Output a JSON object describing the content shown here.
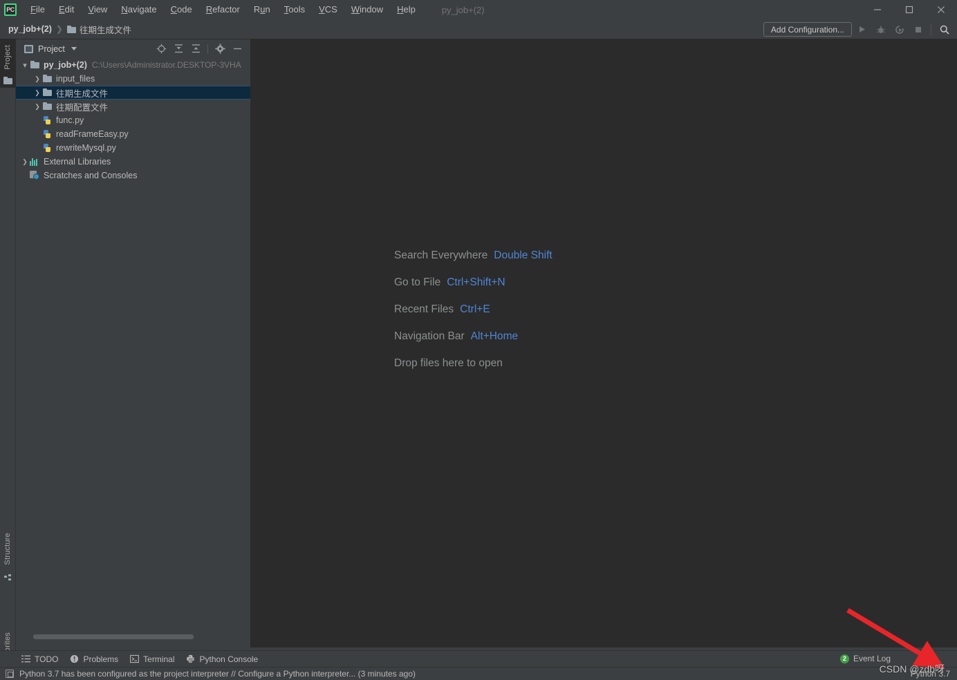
{
  "window": {
    "title": "py_job+(2)",
    "minimize_label": "Minimize",
    "maximize_label": "Maximize",
    "close_label": "Close",
    "logo_text": "PC"
  },
  "menu": {
    "items": [
      {
        "label": "File",
        "mnemonic": "F"
      },
      {
        "label": "Edit",
        "mnemonic": "E"
      },
      {
        "label": "View",
        "mnemonic": "V"
      },
      {
        "label": "Navigate",
        "mnemonic": "N"
      },
      {
        "label": "Code",
        "mnemonic": "C"
      },
      {
        "label": "Refactor",
        "mnemonic": "R"
      },
      {
        "label": "Run",
        "mnemonic": "u"
      },
      {
        "label": "Tools",
        "mnemonic": "T"
      },
      {
        "label": "VCS",
        "mnemonic": "V"
      },
      {
        "label": "Window",
        "mnemonic": "W"
      },
      {
        "label": "Help",
        "mnemonic": "H"
      }
    ]
  },
  "navbar": {
    "project_crumb": "py_job+(2)",
    "separator": "❯",
    "folder_crumb": "往期生成文件",
    "add_configuration": "Add Configuration...",
    "icons": [
      "run-icon",
      "debug-icon",
      "run-coverage-icon",
      "stop-icon",
      "search-icon"
    ]
  },
  "left_rail": {
    "top_label": "Project",
    "structure_label": "Structure",
    "favorites_label": "Favorites"
  },
  "project_panel": {
    "header_label": "Project",
    "toolbar_icons": [
      "select-opened-file-icon",
      "expand-all-icon",
      "collapse-all-icon",
      "settings-gear-icon",
      "hide-icon"
    ],
    "tree": [
      {
        "depth": 0,
        "arrow": "down",
        "icon": "folder-icon",
        "label": "py_job+(2)",
        "bold": true,
        "path": "C:\\Users\\Administrator.DESKTOP-3VHA",
        "selected": false
      },
      {
        "depth": 1,
        "arrow": "right",
        "icon": "folder-icon",
        "label": "input_files",
        "bold": false,
        "path": "",
        "selected": false
      },
      {
        "depth": 1,
        "arrow": "right",
        "icon": "folder-icon",
        "label": "往期生成文件",
        "bold": false,
        "path": "",
        "selected": true
      },
      {
        "depth": 1,
        "arrow": "right",
        "icon": "folder-icon",
        "label": "往期配置文件",
        "bold": false,
        "path": "",
        "selected": false
      },
      {
        "depth": 1,
        "arrow": "none",
        "icon": "python-file-icon",
        "label": "func.py",
        "bold": false,
        "path": "",
        "selected": false
      },
      {
        "depth": 1,
        "arrow": "none",
        "icon": "python-file-icon",
        "label": "readFrameEasy.py",
        "bold": false,
        "path": "",
        "selected": false
      },
      {
        "depth": 1,
        "arrow": "none",
        "icon": "python-file-icon",
        "label": "rewriteMysql.py",
        "bold": false,
        "path": "",
        "selected": false
      },
      {
        "depth": 0,
        "arrow": "right",
        "icon": "external-libraries-icon",
        "label": "External Libraries",
        "bold": false,
        "path": "",
        "selected": false
      },
      {
        "depth": 0,
        "arrow": "none",
        "icon": "scratches-icon",
        "label": "Scratches and Consoles",
        "bold": false,
        "path": "",
        "selected": false
      }
    ]
  },
  "editor": {
    "tips": [
      {
        "label": "Search Everywhere",
        "key": "Double Shift"
      },
      {
        "label": "Go to File",
        "key": "Ctrl+Shift+N"
      },
      {
        "label": "Recent Files",
        "key": "Ctrl+E"
      },
      {
        "label": "Navigation Bar",
        "key": "Alt+Home"
      },
      {
        "label": "Drop files here to open",
        "key": ""
      }
    ]
  },
  "bottom_bar": {
    "items": [
      {
        "label": "TODO",
        "icon": "todo-list-icon"
      },
      {
        "label": "Problems",
        "icon": "problems-icon"
      },
      {
        "label": "Terminal",
        "icon": "terminal-icon"
      },
      {
        "label": "Python Console",
        "icon": "python-console-icon"
      }
    ]
  },
  "status_bar": {
    "icon": "notification-icon",
    "message": "Python 3.7 has been configured as the project interpreter // Configure a Python interpreter... (3 minutes ago)",
    "event_log": {
      "count": "2",
      "label": "Event Log"
    },
    "interpreter": "Python 3.7"
  },
  "watermark": "CSDN @zdb呀",
  "colors": {
    "chrome": "#3c3f41",
    "editor_bg": "#2b2b2b",
    "selection": "#0d293e",
    "selection_border": "#2d5177",
    "accent_blue": "#4e86d6",
    "text": "#bbbbbb",
    "muted": "#7a7a7a",
    "arrow_red": "#e8262a",
    "badge_green": "#43a047"
  }
}
